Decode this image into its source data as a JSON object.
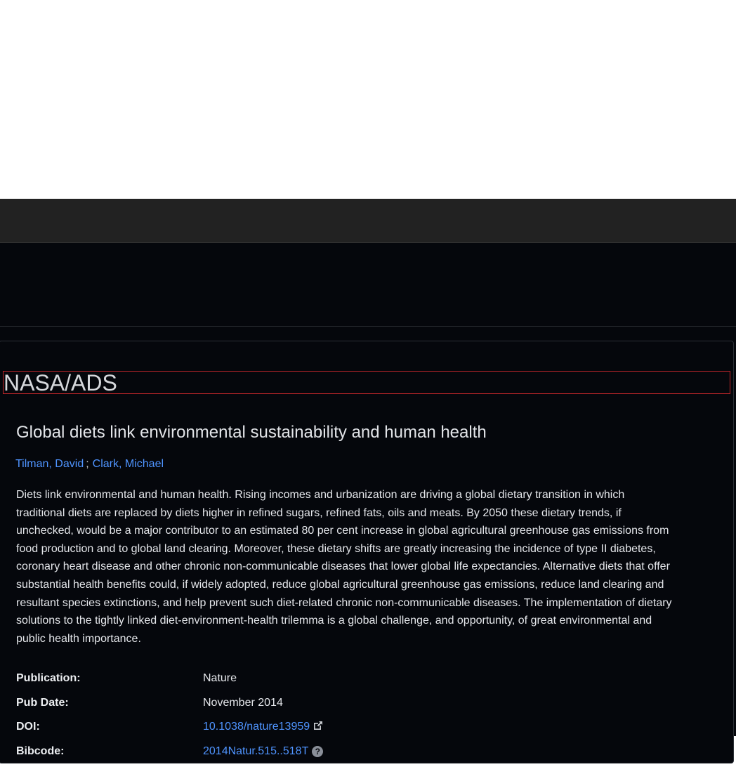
{
  "brand": {
    "name": "NASA/ADS"
  },
  "article": {
    "title": "Global diets link environmental sustainability and human health",
    "authors": [
      {
        "name": "Tilman, David"
      },
      {
        "name": "Clark, Michael"
      }
    ],
    "author_separator": ";",
    "abstract": "Diets link environmental and human health. Rising incomes and urbanization are driving a global dietary transition in which traditional diets are replaced by diets higher in refined sugars, refined fats, oils and meats. By 2050 these dietary trends, if unchecked, would be a major contributor to an estimated 80 per cent increase in global agricultural greenhouse gas emissions from food production and to global land clearing. Moreover, these dietary shifts are greatly increasing the incidence of type II diabetes, coronary heart disease and other chronic non-communicable diseases that lower global life expectancies. Alternative diets that offer substantial health benefits could, if widely adopted, reduce global agricultural greenhouse gas emissions, reduce land clearing and resultant species extinctions, and help prevent such diet-related chronic non-communicable diseases. The implementation of dietary solutions to the tightly linked diet-environment-health trilemma is a global challenge, and opportunity, of great environmental and public health importance."
  },
  "metadata": {
    "publication": {
      "label": "Publication:",
      "value": "Nature"
    },
    "pub_date": {
      "label": "Pub Date:",
      "value": "November 2014"
    },
    "doi": {
      "label": "DOI:",
      "value": "10.1038/nature13959",
      "icon": "external-link-icon"
    },
    "bibcode": {
      "label": "Bibcode:",
      "value": "2014Natur.515..518T",
      "icon": "help-icon"
    }
  },
  "colors": {
    "link": "#4f94ff",
    "background": "#05070c",
    "nav_bar": "#222222",
    "highlight_border": "#c0262a"
  }
}
